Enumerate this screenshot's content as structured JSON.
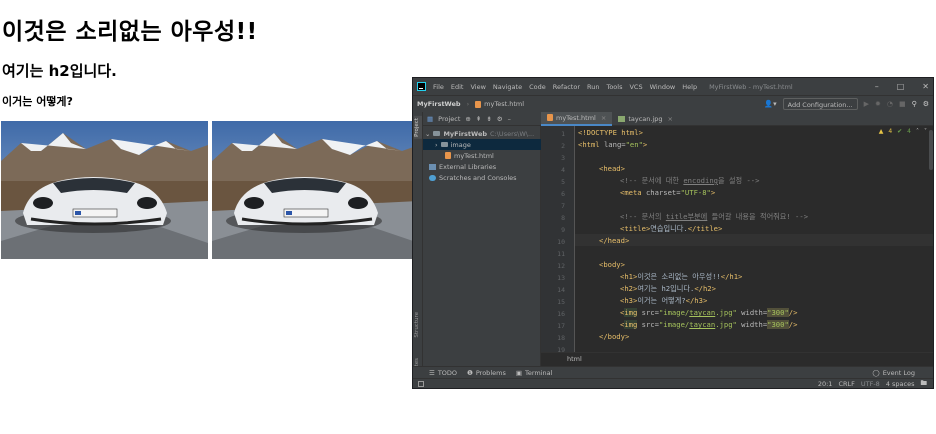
{
  "page": {
    "h1": "이것은 소리없는 아우성!!",
    "h2": "여기는 h2입니다.",
    "h3": "이거는 어떻게?",
    "image_alt": "white sports car on mountain road"
  },
  "ide": {
    "title_bar": {
      "menu": [
        "File",
        "Edit",
        "View",
        "Navigate",
        "Code",
        "Refactor",
        "Run",
        "Tools",
        "VCS",
        "Window",
        "Help"
      ],
      "window_title": "MyFirstWeb - myTest.html",
      "controls": [
        "–",
        "□",
        "✕"
      ]
    },
    "nav_bar": {
      "project": "MyFirstWeb",
      "file": "myTest.html",
      "add_configuration": "Add Configuration..."
    },
    "project_panel": {
      "label": "Project",
      "root": "MyFirstWeb",
      "root_path": "C:\\Users\\W\\...",
      "items": [
        "image",
        "myTest.html",
        "External Libraries",
        "Scratches and Consoles"
      ]
    },
    "side_tabs": {
      "project": "Project",
      "structure": "Structure",
      "favorites": "Favorites"
    },
    "editor_tabs": [
      "myTest.html",
      "taycan.jpg"
    ],
    "inspections": {
      "warnings": "4",
      "ok": "4"
    },
    "code": {
      "line_numbers": [
        "1",
        "2",
        "3",
        "4",
        "5",
        "6",
        "7",
        "8",
        "9",
        "10",
        "11",
        "12",
        "13",
        "14",
        "15",
        "16",
        "17",
        "18",
        "19"
      ],
      "l1": "<!DOCTYPE html>",
      "l2_tag": "<html ",
      "l2_attr": "lang=",
      "l2_val": "\"en\"",
      "l2_end": ">",
      "l4": "<head>",
      "l5_a": "<!-- 문서에 대한 ",
      "l5_b": "encoding",
      "l5_c": "을 설정 -->",
      "l6_tag": "<meta ",
      "l6_attr": "charset=",
      "l6_val": "\"UTF-8\"",
      "l6_end": ">",
      "l8_a": "<!-- 문서의 ",
      "l8_b": "title부분에",
      "l8_c": " 들어갈 내용을 적어줘요! -->",
      "l9_open": "<title>",
      "l9_text": "연습입니다.",
      "l9_close": "</title>",
      "l10": "</head>",
      "l12": "<body>",
      "l13_open": "<h1>",
      "l13_text": "이것은 소리없는 아우성!!",
      "l13_close": "</h1>",
      "l14_open": "<h2>",
      "l14_text": "여기는 h2입니다.",
      "l14_close": "</h2>",
      "l15_open": "<h3>",
      "l15_text": "이거는 어떻게?",
      "l15_close": "</h3>",
      "img_open": "<",
      "img_tag": "img",
      "img_src_attr": " src=",
      "img_src_val1": "\"image/",
      "img_src_val2": "taycan",
      "img_src_val3": ".jpg\"",
      "img_w_attr": " width=",
      "img_w_val": "\"300\"",
      "img_end": "/>",
      "l18": "</body>"
    },
    "editor_breadcrumb": "html",
    "tool_windows": [
      "TODO",
      "Problems",
      "Terminal"
    ],
    "event_log": "Event Log",
    "status": {
      "position": "20:1",
      "line_sep": "CRLF",
      "encoding": "UTF-8",
      "indent": "4 spaces"
    }
  }
}
